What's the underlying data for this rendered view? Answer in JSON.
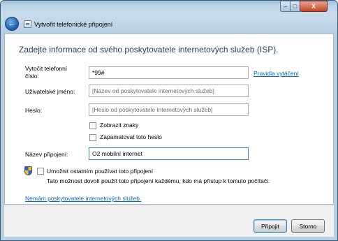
{
  "window": {
    "title": "Vytvořit telefonické připojení",
    "controls": {
      "minimize": "–",
      "maximize": "□",
      "close": "X"
    }
  },
  "heading": "Zadejte informace od svého poskytovatele internetových služeb (ISP).",
  "form": {
    "phone": {
      "label_line1": "Vytočit telefonní",
      "label_line2": "číslo:",
      "value": "*99#"
    },
    "dialing_rules_link": "Pravidla vytáčení",
    "username": {
      "label": "Uživatelské jméno:",
      "placeholder": "[Název od poskytovatele internetových služeb]"
    },
    "password": {
      "label": "Heslo:",
      "placeholder": "[Heslo od poskytovatele internetových služeb]"
    },
    "show_chars": {
      "label": "Zobrazit znaky",
      "checked": false
    },
    "remember_password": {
      "label": "Zapamatovat toto heslo",
      "checked": false
    },
    "connection_name": {
      "label": "Název připojení:",
      "value": "O2 mobilní internet"
    },
    "allow_others": {
      "label": "Umožnit ostatním používat toto připojení",
      "description": "Tato možnost dovolí použít toto připojení každému, kdo má přístup k tomuto počítači.",
      "checked": false
    },
    "no_isp_link": "Nemám poskytovatele internetových služeb."
  },
  "buttons": {
    "connect": "Připojit",
    "cancel": "Storno"
  },
  "colors": {
    "heading": "#1e395b",
    "link": "#0066cc",
    "accent_border": "#3c7fb1"
  }
}
